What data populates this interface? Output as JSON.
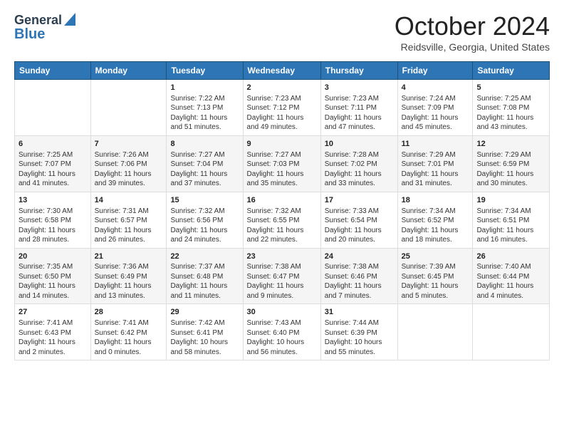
{
  "header": {
    "logo_line1": "General",
    "logo_line2": "Blue",
    "month": "October 2024",
    "location": "Reidsville, Georgia, United States"
  },
  "days_of_week": [
    "Sunday",
    "Monday",
    "Tuesday",
    "Wednesday",
    "Thursday",
    "Friday",
    "Saturday"
  ],
  "weeks": [
    [
      {
        "day": "",
        "sunrise": "",
        "sunset": "",
        "daylight": ""
      },
      {
        "day": "",
        "sunrise": "",
        "sunset": "",
        "daylight": ""
      },
      {
        "day": "1",
        "sunrise": "Sunrise: 7:22 AM",
        "sunset": "Sunset: 7:13 PM",
        "daylight": "Daylight: 11 hours and 51 minutes."
      },
      {
        "day": "2",
        "sunrise": "Sunrise: 7:23 AM",
        "sunset": "Sunset: 7:12 PM",
        "daylight": "Daylight: 11 hours and 49 minutes."
      },
      {
        "day": "3",
        "sunrise": "Sunrise: 7:23 AM",
        "sunset": "Sunset: 7:11 PM",
        "daylight": "Daylight: 11 hours and 47 minutes."
      },
      {
        "day": "4",
        "sunrise": "Sunrise: 7:24 AM",
        "sunset": "Sunset: 7:09 PM",
        "daylight": "Daylight: 11 hours and 45 minutes."
      },
      {
        "day": "5",
        "sunrise": "Sunrise: 7:25 AM",
        "sunset": "Sunset: 7:08 PM",
        "daylight": "Daylight: 11 hours and 43 minutes."
      }
    ],
    [
      {
        "day": "6",
        "sunrise": "Sunrise: 7:25 AM",
        "sunset": "Sunset: 7:07 PM",
        "daylight": "Daylight: 11 hours and 41 minutes."
      },
      {
        "day": "7",
        "sunrise": "Sunrise: 7:26 AM",
        "sunset": "Sunset: 7:06 PM",
        "daylight": "Daylight: 11 hours and 39 minutes."
      },
      {
        "day": "8",
        "sunrise": "Sunrise: 7:27 AM",
        "sunset": "Sunset: 7:04 PM",
        "daylight": "Daylight: 11 hours and 37 minutes."
      },
      {
        "day": "9",
        "sunrise": "Sunrise: 7:27 AM",
        "sunset": "Sunset: 7:03 PM",
        "daylight": "Daylight: 11 hours and 35 minutes."
      },
      {
        "day": "10",
        "sunrise": "Sunrise: 7:28 AM",
        "sunset": "Sunset: 7:02 PM",
        "daylight": "Daylight: 11 hours and 33 minutes."
      },
      {
        "day": "11",
        "sunrise": "Sunrise: 7:29 AM",
        "sunset": "Sunset: 7:01 PM",
        "daylight": "Daylight: 11 hours and 31 minutes."
      },
      {
        "day": "12",
        "sunrise": "Sunrise: 7:29 AM",
        "sunset": "Sunset: 6:59 PM",
        "daylight": "Daylight: 11 hours and 30 minutes."
      }
    ],
    [
      {
        "day": "13",
        "sunrise": "Sunrise: 7:30 AM",
        "sunset": "Sunset: 6:58 PM",
        "daylight": "Daylight: 11 hours and 28 minutes."
      },
      {
        "day": "14",
        "sunrise": "Sunrise: 7:31 AM",
        "sunset": "Sunset: 6:57 PM",
        "daylight": "Daylight: 11 hours and 26 minutes."
      },
      {
        "day": "15",
        "sunrise": "Sunrise: 7:32 AM",
        "sunset": "Sunset: 6:56 PM",
        "daylight": "Daylight: 11 hours and 24 minutes."
      },
      {
        "day": "16",
        "sunrise": "Sunrise: 7:32 AM",
        "sunset": "Sunset: 6:55 PM",
        "daylight": "Daylight: 11 hours and 22 minutes."
      },
      {
        "day": "17",
        "sunrise": "Sunrise: 7:33 AM",
        "sunset": "Sunset: 6:54 PM",
        "daylight": "Daylight: 11 hours and 20 minutes."
      },
      {
        "day": "18",
        "sunrise": "Sunrise: 7:34 AM",
        "sunset": "Sunset: 6:52 PM",
        "daylight": "Daylight: 11 hours and 18 minutes."
      },
      {
        "day": "19",
        "sunrise": "Sunrise: 7:34 AM",
        "sunset": "Sunset: 6:51 PM",
        "daylight": "Daylight: 11 hours and 16 minutes."
      }
    ],
    [
      {
        "day": "20",
        "sunrise": "Sunrise: 7:35 AM",
        "sunset": "Sunset: 6:50 PM",
        "daylight": "Daylight: 11 hours and 14 minutes."
      },
      {
        "day": "21",
        "sunrise": "Sunrise: 7:36 AM",
        "sunset": "Sunset: 6:49 PM",
        "daylight": "Daylight: 11 hours and 13 minutes."
      },
      {
        "day": "22",
        "sunrise": "Sunrise: 7:37 AM",
        "sunset": "Sunset: 6:48 PM",
        "daylight": "Daylight: 11 hours and 11 minutes."
      },
      {
        "day": "23",
        "sunrise": "Sunrise: 7:38 AM",
        "sunset": "Sunset: 6:47 PM",
        "daylight": "Daylight: 11 hours and 9 minutes."
      },
      {
        "day": "24",
        "sunrise": "Sunrise: 7:38 AM",
        "sunset": "Sunset: 6:46 PM",
        "daylight": "Daylight: 11 hours and 7 minutes."
      },
      {
        "day": "25",
        "sunrise": "Sunrise: 7:39 AM",
        "sunset": "Sunset: 6:45 PM",
        "daylight": "Daylight: 11 hours and 5 minutes."
      },
      {
        "day": "26",
        "sunrise": "Sunrise: 7:40 AM",
        "sunset": "Sunset: 6:44 PM",
        "daylight": "Daylight: 11 hours and 4 minutes."
      }
    ],
    [
      {
        "day": "27",
        "sunrise": "Sunrise: 7:41 AM",
        "sunset": "Sunset: 6:43 PM",
        "daylight": "Daylight: 11 hours and 2 minutes."
      },
      {
        "day": "28",
        "sunrise": "Sunrise: 7:41 AM",
        "sunset": "Sunset: 6:42 PM",
        "daylight": "Daylight: 11 hours and 0 minutes."
      },
      {
        "day": "29",
        "sunrise": "Sunrise: 7:42 AM",
        "sunset": "Sunset: 6:41 PM",
        "daylight": "Daylight: 10 hours and 58 minutes."
      },
      {
        "day": "30",
        "sunrise": "Sunrise: 7:43 AM",
        "sunset": "Sunset: 6:40 PM",
        "daylight": "Daylight: 10 hours and 56 minutes."
      },
      {
        "day": "31",
        "sunrise": "Sunrise: 7:44 AM",
        "sunset": "Sunset: 6:39 PM",
        "daylight": "Daylight: 10 hours and 55 minutes."
      },
      {
        "day": "",
        "sunrise": "",
        "sunset": "",
        "daylight": ""
      },
      {
        "day": "",
        "sunrise": "",
        "sunset": "",
        "daylight": ""
      }
    ]
  ]
}
